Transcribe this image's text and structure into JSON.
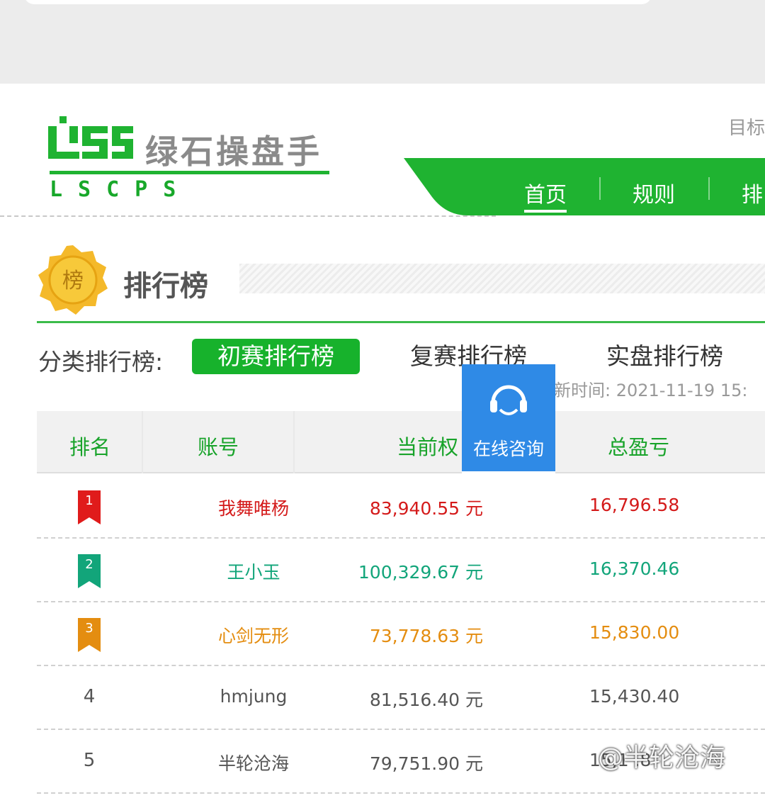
{
  "header": {
    "brand_name": "绿石操盘手",
    "brand_sub": "LSCPS",
    "top_right_1": "",
    "top_right_2": "目标",
    "colors": {
      "brand_green": "#17b22c",
      "nav_green": "#1fb331"
    }
  },
  "nav": {
    "items": [
      {
        "label": "首页",
        "active": true
      },
      {
        "label": "规则",
        "active": false
      },
      {
        "label": "排",
        "active": false
      }
    ]
  },
  "ranking": {
    "badge_icon_text": "榜",
    "title": "排行榜",
    "category_label": "分类排行榜:",
    "tabs": [
      "初赛排行榜",
      "复赛排行榜",
      "实盘排行榜"
    ],
    "update_time": "新时间: 2021-11-19 15:"
  },
  "table": {
    "headers": [
      "排名",
      "账号",
      "当前权",
      "总盈亏"
    ],
    "rows": [
      {
        "rank": "1",
        "name": "我舞唯杨",
        "equity": "83,940.55 元",
        "pl": "16,796.58",
        "color": "#d41a1a"
      },
      {
        "rank": "2",
        "name": "王小玉",
        "equity": "100,329.67 元",
        "pl": "16,370.46",
        "color": "#12a57a"
      },
      {
        "rank": "3",
        "name": "心剑无形",
        "equity": "73,778.63 元",
        "pl": "15,830.00",
        "color": "#e48d10"
      },
      {
        "rank": "4",
        "name": "hmjung",
        "equity": "81,516.40 元",
        "pl": "15,430.40",
        "color": "#555555"
      },
      {
        "rank": "5",
        "name": "半轮沧海",
        "equity": "79,751.90 元",
        "pl": "15,1 .8",
        "color": "#555555"
      }
    ]
  },
  "chat": {
    "label": "在线咨询",
    "icon": "headset-icon",
    "color": "#2f8ae6"
  },
  "watermark": "@半轮沧海"
}
